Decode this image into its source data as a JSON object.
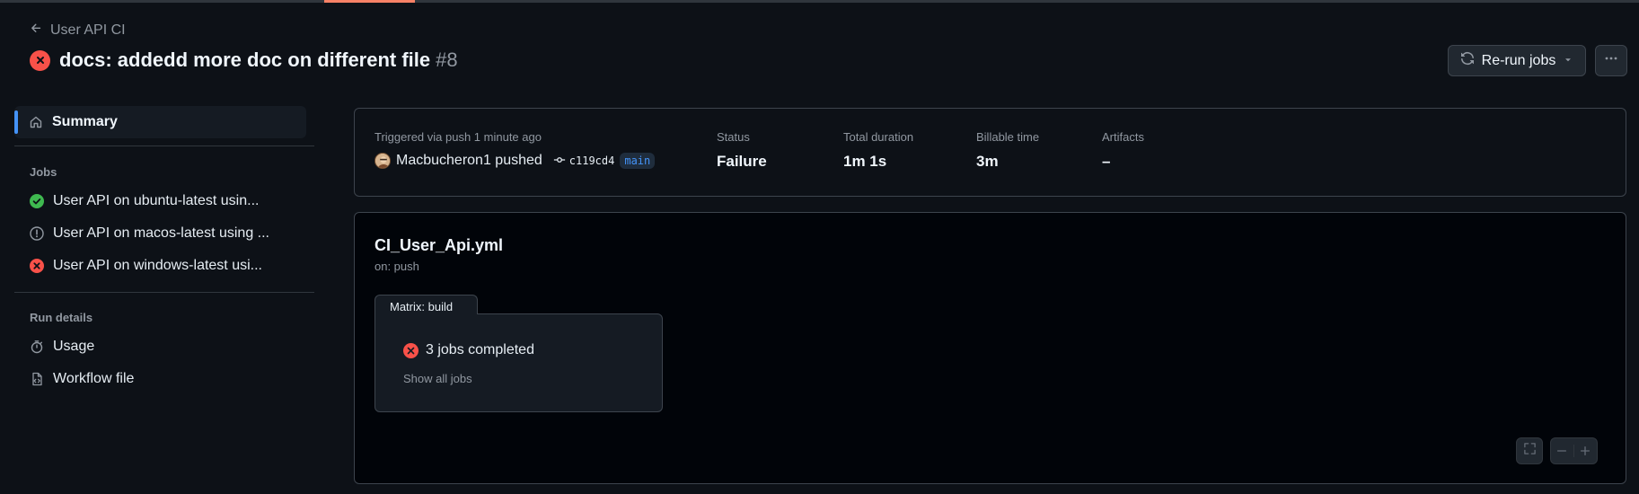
{
  "back_link": {
    "label": "User API CI"
  },
  "run": {
    "title": "docs: addedd more doc on different file",
    "number": "#8",
    "status_icon": "x-circle-fill-icon",
    "status_color": "#f85149"
  },
  "actions": {
    "rerun_label": "Re-run jobs",
    "more_label": "More actions"
  },
  "sidebar": {
    "summary_label": "Summary",
    "jobs_heading": "Jobs",
    "jobs": [
      {
        "label": "User API on ubuntu-latest usin...",
        "status": "success"
      },
      {
        "label": "User API on macos-latest using ...",
        "status": "cancelled"
      },
      {
        "label": "User API on windows-latest usi...",
        "status": "failure"
      }
    ],
    "run_details_heading": "Run details",
    "run_details": [
      {
        "label": "Usage",
        "icon": "stopwatch-icon"
      },
      {
        "label": "Workflow file",
        "icon": "file-code-icon"
      }
    ]
  },
  "summary": {
    "triggered_text": "Triggered via push 1 minute ago",
    "actor": "Macbucheron1 pushed",
    "commit": "c119cd4",
    "branch": "main",
    "status_label": "Status",
    "status_value": "Failure",
    "duration_label": "Total duration",
    "duration_value": "1m 1s",
    "billable_label": "Billable time",
    "billable_value": "3m",
    "artifacts_label": "Artifacts",
    "artifacts_value": "–"
  },
  "graph": {
    "workflow_name": "CI_User_Api.yml",
    "trigger": "on: push",
    "matrix_label": "Matrix: build",
    "jobs_completed": "3 jobs completed",
    "show_all": "Show all jobs"
  }
}
